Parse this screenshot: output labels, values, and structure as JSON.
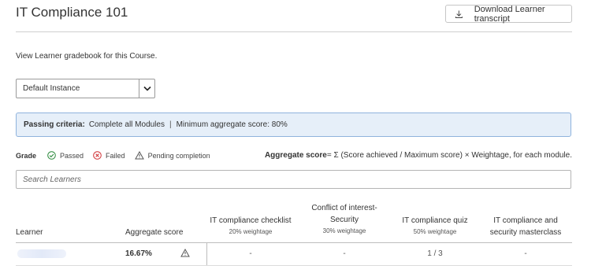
{
  "header": {
    "title": "IT Compliance 101",
    "download_label": "Download Learner transcript"
  },
  "intro": "View Learner gradebook for this Course.",
  "instance_select": {
    "value": "Default Instance"
  },
  "criteria": {
    "label": "Passing criteria:",
    "modules": "Complete all Modules",
    "separator": "|",
    "min_score": "Minimum aggregate score: 80%"
  },
  "legend": {
    "grade": "Grade",
    "passed": "Passed",
    "failed": "Failed",
    "pending": "Pending completion"
  },
  "formula": {
    "label": "Aggregate score",
    "text": "= Σ (Score achieved / Maximum score) × Weightage, for each module."
  },
  "search": {
    "placeholder": "Search Learners"
  },
  "table": {
    "columns": {
      "learner": "Learner",
      "aggregate": "Aggregate score",
      "checklist": {
        "title": "IT compliance checklist",
        "weight": "20% weightage"
      },
      "conflict": {
        "title_line1": "Conflict of interest-",
        "title_line2": "Security",
        "weight": "30% weightage"
      },
      "quiz": {
        "title": "IT compliance quiz",
        "weight": "50% weightage"
      },
      "masterclass": {
        "title_line1": "IT compliance and",
        "title_line2": "security masterclass"
      }
    },
    "rows": [
      {
        "aggregate": "16.67%",
        "checklist": "-",
        "conflict": "-",
        "quiz": "1 / 3",
        "masterclass": "-"
      }
    ]
  },
  "colors": {
    "accent_bg": "#e6eff9",
    "accent_border": "#8fb3dd",
    "passed": "#2e8b3e",
    "failed": "#d13438"
  }
}
